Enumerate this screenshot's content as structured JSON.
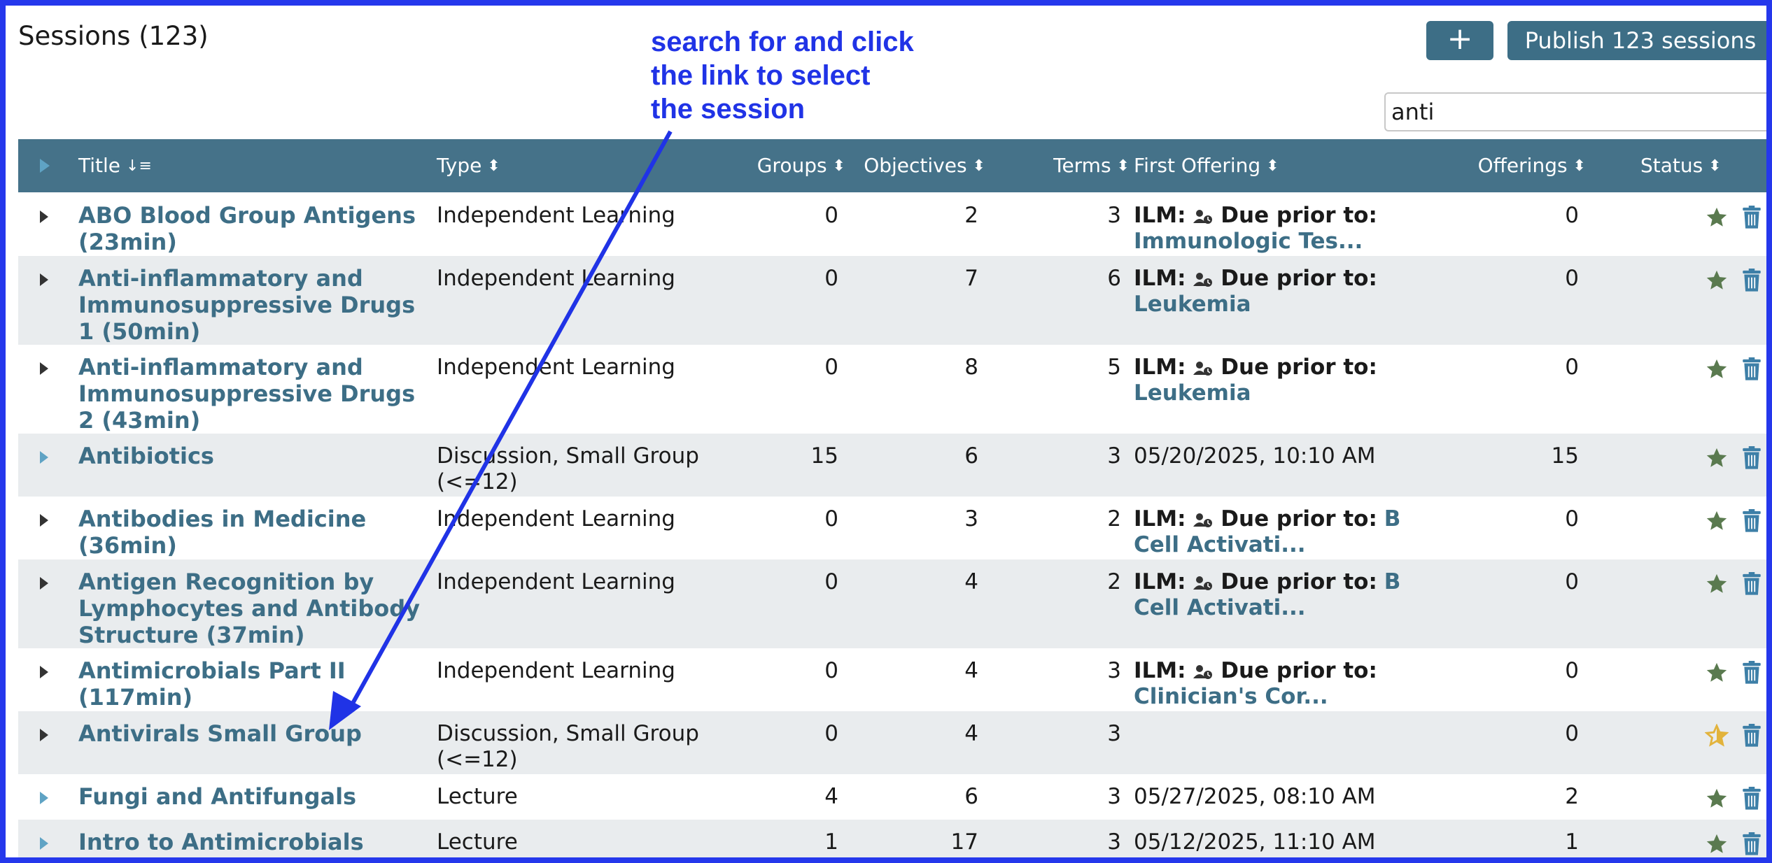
{
  "page": {
    "title": "Sessions (123)",
    "add_label": "+",
    "publish_label": "Publish 123 sessions",
    "search_value": "anti"
  },
  "annotation": {
    "lines": [
      "search for and click",
      "the link to select",
      "the session"
    ],
    "color": "#2033e6"
  },
  "colors": {
    "header_bg": "#457289",
    "link": "#3d6e86",
    "button_bg": "#3d6e86",
    "star_published": "#5a7a4f",
    "star_unpublished": "#e2b33c",
    "trash": "#3d7fa7"
  },
  "columns": {
    "title": "Title",
    "type": "Type",
    "groups": "Groups",
    "objectives": "Objectives",
    "terms": "Terms",
    "first_offering": "First Offering",
    "offerings": "Offerings",
    "status": "Status"
  },
  "ilm_label": "ILM:",
  "due_label": "Due prior to:",
  "rows": [
    {
      "title": "ABO Blood Group Antigens (23min)",
      "type": "Independent Learning",
      "groups": "0",
      "objectives": "2",
      "terms": "3",
      "first_offering_link": "Immunologic Tes...",
      "offerings": "0",
      "status": "published"
    },
    {
      "title": "Anti-inflammatory and Immunosuppressive Drugs 1 (50min)",
      "type": "Independent Learning",
      "groups": "0",
      "objectives": "7",
      "terms": "6",
      "first_offering_link": "Leukemia",
      "offerings": "0",
      "status": "published"
    },
    {
      "title": "Anti-inflammatory and Immunosuppressive Drugs 2 (43min)",
      "type": "Independent Learning",
      "groups": "0",
      "objectives": "8",
      "terms": "5",
      "first_offering_link": "Leukemia",
      "offerings": "0",
      "status": "published"
    },
    {
      "title": "Antibiotics",
      "type": "Discussion, Small Group (<=12)",
      "groups": "15",
      "objectives": "6",
      "terms": "3",
      "first_offering_text": "05/20/2025, 10:10 AM",
      "offerings": "15",
      "status": "published"
    },
    {
      "title": "Antibodies in Medicine (36min)",
      "type": "Independent Learning",
      "groups": "0",
      "objectives": "3",
      "terms": "2",
      "first_offering_link": "B Cell Activati...",
      "offerings": "0",
      "status": "published"
    },
    {
      "title": "Antigen Recognition by Lymphocytes and Antibody Structure (37min)",
      "type": "Independent Learning",
      "groups": "0",
      "objectives": "4",
      "terms": "2",
      "first_offering_link": "B Cell Activati...",
      "offerings": "0",
      "status": "published"
    },
    {
      "title": "Antimicrobials Part II (117min)",
      "type": "Independent Learning",
      "groups": "0",
      "objectives": "4",
      "terms": "3",
      "first_offering_link": "Clinician's Cor...",
      "offerings": "0",
      "status": "published"
    },
    {
      "title": "Antivirals Small Group",
      "type": "Discussion, Small Group (<=12)",
      "groups": "0",
      "objectives": "4",
      "terms": "3",
      "first_offering_text": "",
      "offerings": "0",
      "status": "unpublished"
    },
    {
      "title": "Fungi and Antifungals",
      "type": "Lecture",
      "groups": "4",
      "objectives": "6",
      "terms": "3",
      "first_offering_text": "05/27/2025, 08:10 AM",
      "offerings": "2",
      "status": "published"
    },
    {
      "title": "Intro to Antimicrobials",
      "type": "Lecture",
      "groups": "1",
      "objectives": "17",
      "terms": "3",
      "first_offering_text": "05/12/2025, 11:10 AM",
      "offerings": "1",
      "status": "published"
    }
  ]
}
